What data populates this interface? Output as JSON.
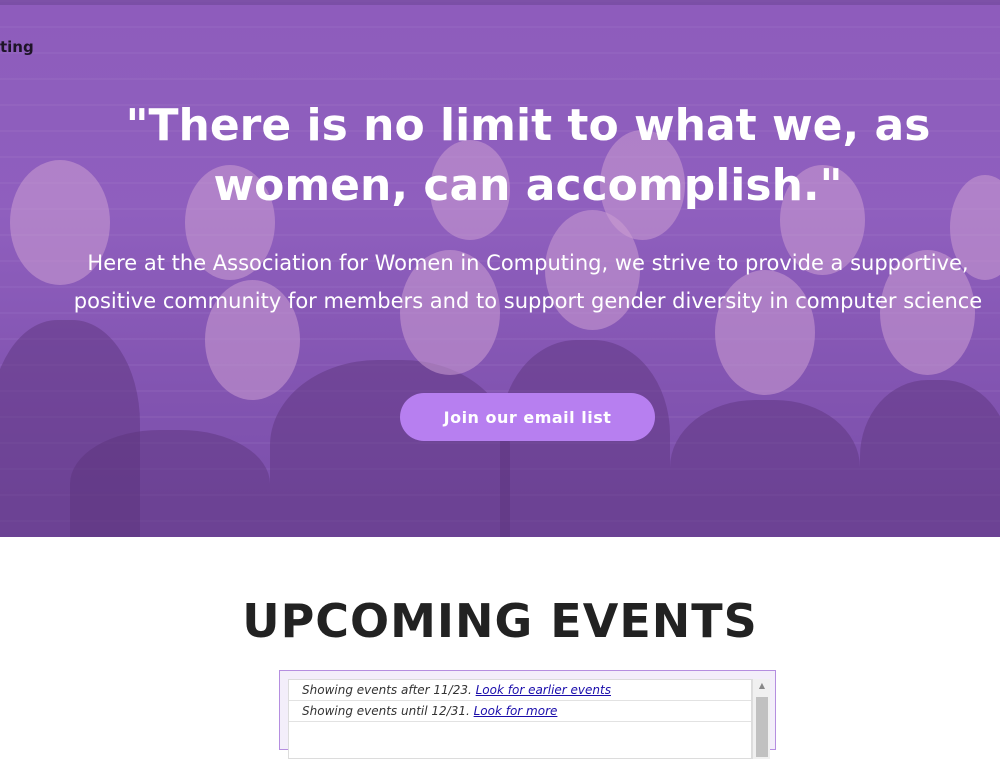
{
  "header": {
    "brand_fragment": "ting"
  },
  "hero": {
    "quote": "\"There is no limit to what we, as women, can accomplish.\"",
    "mission": "Here at the Association for Women in Computing, we strive to provide a supportive, positive community for members and to support gender diversity in computer science",
    "cta_label": "Join our email list",
    "overlay_color": "#9a5fd0",
    "button_color": "#b77ff0"
  },
  "events": {
    "title": "UPCOMING EVENTS",
    "calendar": {
      "row1_text": "Showing events after 11/23. ",
      "row1_link": "Look for earlier events",
      "row2_text": "Showing events until 12/31. ",
      "row2_link": "Look for more"
    }
  }
}
